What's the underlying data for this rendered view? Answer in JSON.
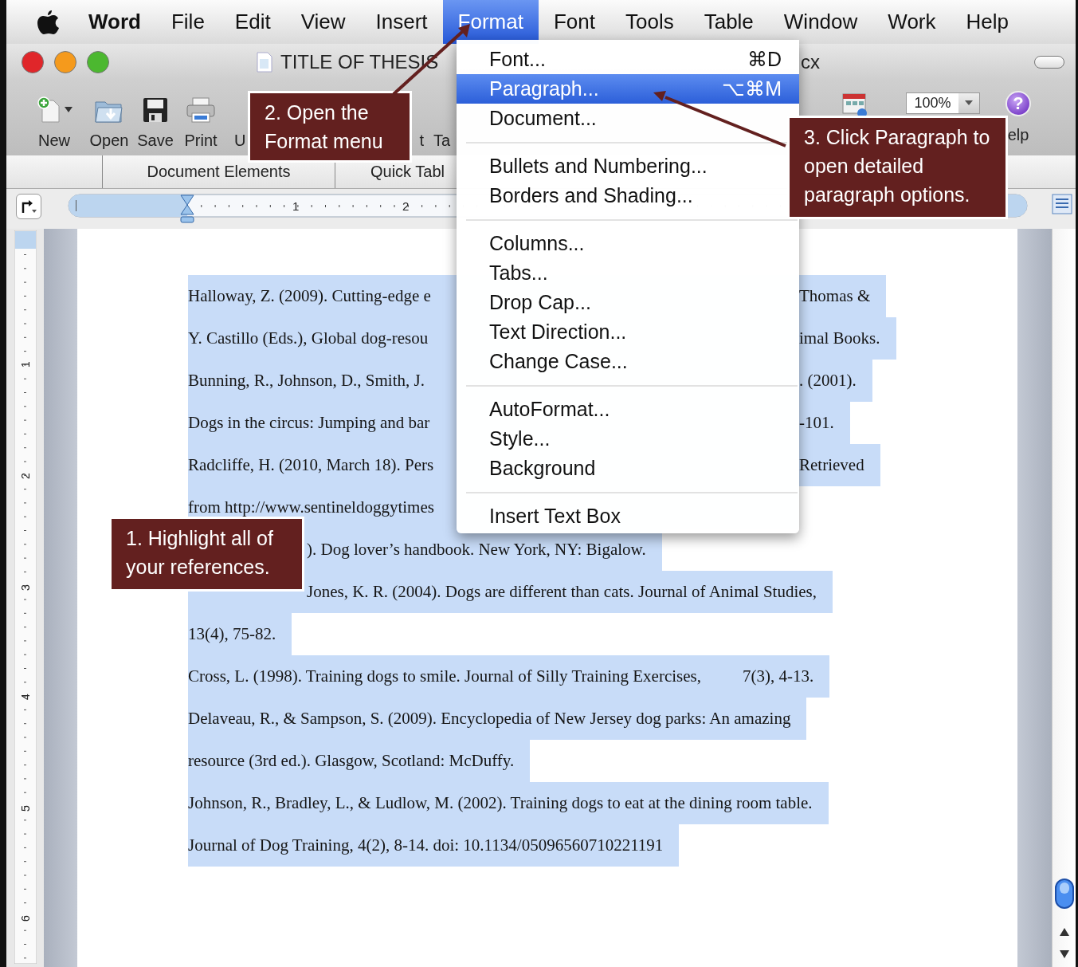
{
  "menu_bar": {
    "items": [
      {
        "label": "Word",
        "kind": "app",
        "selected": false
      },
      {
        "label": "File",
        "kind": "menu",
        "selected": false
      },
      {
        "label": "Edit",
        "kind": "menu",
        "selected": false
      },
      {
        "label": "View",
        "kind": "menu",
        "selected": false
      },
      {
        "label": "Insert",
        "kind": "menu",
        "selected": false
      },
      {
        "label": "Format",
        "kind": "menu",
        "selected": true
      },
      {
        "label": "Font",
        "kind": "menu",
        "selected": false
      },
      {
        "label": "Tools",
        "kind": "menu",
        "selected": false
      },
      {
        "label": "Table",
        "kind": "menu",
        "selected": false
      },
      {
        "label": "Window",
        "kind": "menu",
        "selected": false
      },
      {
        "label": "Work",
        "kind": "menu",
        "selected": false
      },
      {
        "label": "Help",
        "kind": "menu",
        "selected": false
      }
    ]
  },
  "window": {
    "title": "TITLE OF THESIS",
    "title_end": "cx"
  },
  "toolbar": {
    "buttons": [
      {
        "label": "New",
        "kind": "new"
      },
      {
        "label": "Open",
        "kind": "open"
      },
      {
        "label": "Save",
        "kind": "save"
      },
      {
        "label": "Print",
        "kind": "print"
      }
    ],
    "partial_labels": [
      "U",
      "t",
      "Ta"
    ],
    "zoom": "100%",
    "help_icon": "?",
    "help_label": "elp"
  },
  "ribbon": {
    "tabs": [
      {
        "label": "Document Elements"
      },
      {
        "label": "Quick Tabl"
      }
    ]
  },
  "ruler": {
    "marks": [
      "1",
      "2"
    ]
  },
  "vertical_ruler": {
    "marks": [
      "1",
      "2",
      "3",
      "4",
      "5",
      "6"
    ]
  },
  "document": {
    "selected": true,
    "lines": [
      {
        "kind": "menu_split",
        "texts": [
          "Halloway, Z. (2009). Cutting-edge e",
          "Thomas &"
        ]
      },
      {
        "kind": "menu_split",
        "texts": [
          "Y. Castillo (Eds.), Global dog-resou",
          "imal Books."
        ]
      },
      {
        "kind": "menu_split",
        "texts": [
          "Bunning, R., Johnson, D., Smith, J.",
          ". (2001)."
        ]
      },
      {
        "kind": "menu_split",
        "texts": [
          "Dogs in the circus: Jumping and bar",
          "-101."
        ]
      },
      {
        "kind": "menu_split",
        "texts": [
          "Radcliffe, H. (2010, March 18). Pers",
          "Retrieved"
        ]
      },
      {
        "kind": "menu_split",
        "texts": [
          "from http://www.sentineldoggytimes"
        ]
      },
      {
        "kind": "covered",
        "texts": [
          "). Dog lover’s handbook. New York, NY: Bigalow."
        ]
      },
      {
        "kind": "covered",
        "texts": [
          "Jones, K. R. (2004). Dogs are different than cats. Journal of Animal Studies,"
        ]
      },
      {
        "kind": "full",
        "texts": [
          "13(4), 75-82."
        ]
      },
      {
        "kind": "full",
        "texts": [
          "Cross, L. (1998). Training dogs to smile. Journal of Silly Training Exercises,",
          "7(3), 4-13."
        ]
      },
      {
        "kind": "full",
        "texts": [
          "Delaveau, R., & Sampson, S. (2009). Encyclopedia of New Jersey dog parks: An amazing"
        ]
      },
      {
        "kind": "full",
        "texts": [
          "resource (3rd ed.). Glasgow, Scotland: McDuffy."
        ]
      },
      {
        "kind": "full",
        "texts": [
          "Johnson, R., Bradley, L., & Ludlow, M. (2002). Training dogs to eat at the dining room table."
        ]
      },
      {
        "kind": "full",
        "texts": [
          "Journal of Dog Training, 4(2), 8-14. doi: 10.1134/05096560710221191"
        ]
      }
    ]
  },
  "format_menu": {
    "groups": [
      [
        {
          "label": "Font...",
          "shortcut": "⌘D",
          "selected": false
        },
        {
          "label": "Paragraph...",
          "shortcut": "⌥⌘M",
          "selected": true
        },
        {
          "label": "Document...",
          "selected": false
        }
      ],
      [
        {
          "label": "Bullets and Numbering...",
          "selected": false
        },
        {
          "label": "Borders and Shading...",
          "selected": false
        }
      ],
      [
        {
          "label": "Columns...",
          "selected": false
        },
        {
          "label": "Tabs...",
          "selected": false
        },
        {
          "label": "Drop Cap...",
          "selected": false
        },
        {
          "label": "Text Direction...",
          "selected": false
        },
        {
          "label": "Change Case...",
          "selected": false
        }
      ],
      [
        {
          "label": "AutoFormat...",
          "selected": false
        },
        {
          "label": "Style...",
          "selected": false
        },
        {
          "label": "Background",
          "selected": false
        }
      ],
      [
        {
          "label": "Insert Text Box",
          "selected": false
        }
      ]
    ]
  },
  "callouts": [
    {
      "text": "1. Highlight all of your references."
    },
    {
      "text": "2. Open the Format menu"
    },
    {
      "text": "3. Click Paragraph to open detailed paragraph options."
    }
  ]
}
